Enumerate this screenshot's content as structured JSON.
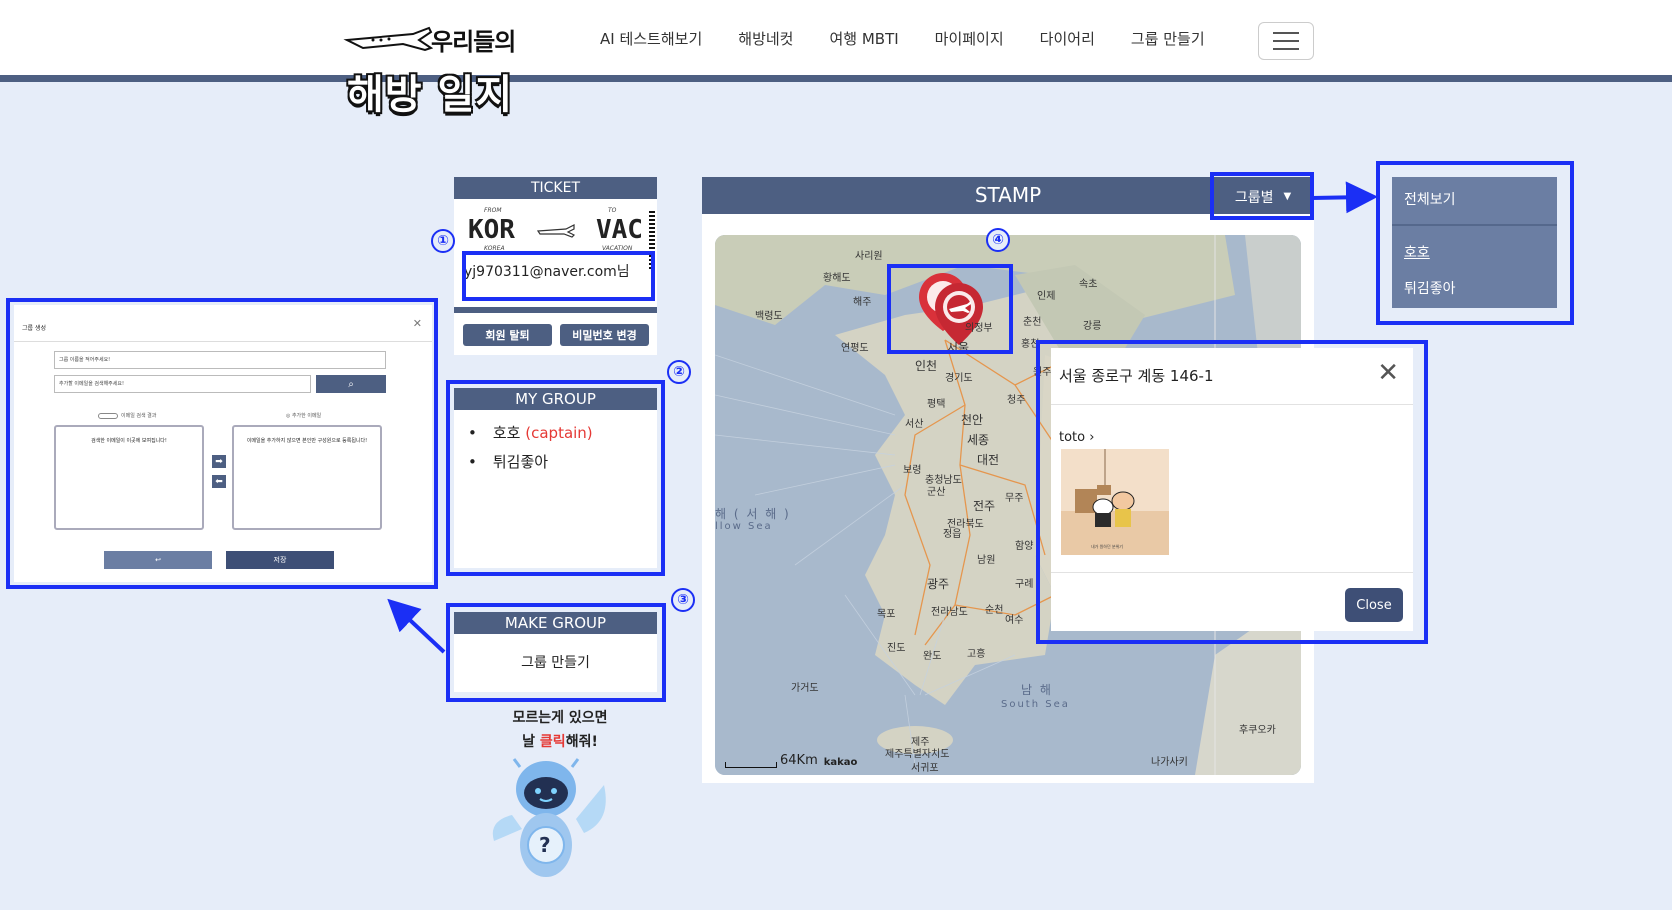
{
  "brand": {
    "line1": "우리들의",
    "line2": "해방 일지"
  },
  "nav": {
    "items": [
      "AI 테스트해보기",
      "해방네컷",
      "여행 MBTI",
      "마이페이지",
      "다이어리",
      "그룹 만들기"
    ]
  },
  "ticket": {
    "header": "TICKET",
    "from_small": "FROM",
    "from": "KOR",
    "from_sub": "KOREA",
    "to_small": "TO",
    "to": "VAC",
    "to_sub": "VACATION",
    "email": "yj970311@naver.com님",
    "withdraw_label": "회원 탈퇴",
    "change_password_label": "비밀번호 변경"
  },
  "my_group": {
    "header": "MY GROUP",
    "groups": [
      {
        "name": "호호",
        "role": "(captain)"
      },
      {
        "name": "튀김좋아"
      }
    ]
  },
  "make_group": {
    "header": "MAKE GROUP",
    "button_label": "그룹 만들기"
  },
  "help": {
    "line1": "모르는게 있으면",
    "line2_pre": "날 ",
    "line2_red": "클릭",
    "line2_post": "해줘!",
    "bot_mark": "?"
  },
  "stamp": {
    "header": "STAMP",
    "sort_label": "그룹별",
    "scale": "64Km",
    "attribution": "kakao"
  },
  "dropdown": {
    "items": [
      "전체보기",
      "호호",
      "튀김좋아"
    ]
  },
  "popup": {
    "title": "서울 종로구 계동 146-1",
    "user": "toto",
    "close_label": "Close",
    "image_caption": "내가 원하던 분위기"
  },
  "modal_preview": {
    "title": "그룹 생성",
    "name_placeholder": "그룹 이름을 적어주세요!",
    "email_placeholder": "추가할 이메일을 검색해주세요!",
    "search_result_label": "이메일 검색 결과",
    "added_label": "추가한 이메일",
    "left_box_text": "검색한 이메일이 이곳에 보여집니다!",
    "right_box_text": "이메일을 추가하지 않으면 본인만 구성원으로 등록됩니다!",
    "reset_label": "↩",
    "save_label": "저장"
  },
  "markers": [
    "①",
    "②",
    "③",
    "④"
  ],
  "map_labels": {
    "cities": [
      "사리원",
      "해주",
      "인천",
      "서울",
      "의정부",
      "춘천",
      "강릉",
      "원주",
      "천안",
      "세종",
      "대전",
      "청주",
      "서산",
      "군산",
      "전주",
      "정읍",
      "광주",
      "남원",
      "목포",
      "진도",
      "완도",
      "고흥",
      "순천",
      "여수",
      "제주",
      "서귀포",
      "평택",
      "무주",
      "인제",
      "속초",
      "구례",
      "함양",
      "보령",
      "홍천",
      "가거도",
      "나가사키",
      "후쿠오카",
      "제주특별자치도",
      "제주특별자치도"
    ],
    "regions": [
      "황해도",
      "백령도",
      "연평도",
      "경기도",
      "충청남도",
      "전라북도",
      "전라남도",
      "제주특별자치도"
    ],
    "seas": [
      "해 ( 서 해 )",
      "llow Sea",
      "남 해",
      "South Sea"
    ]
  },
  "colors": {
    "navy": "#4d5f82",
    "highlight": "#1b2ff5",
    "background": "#e6edf9",
    "captain": "#e53935"
  }
}
